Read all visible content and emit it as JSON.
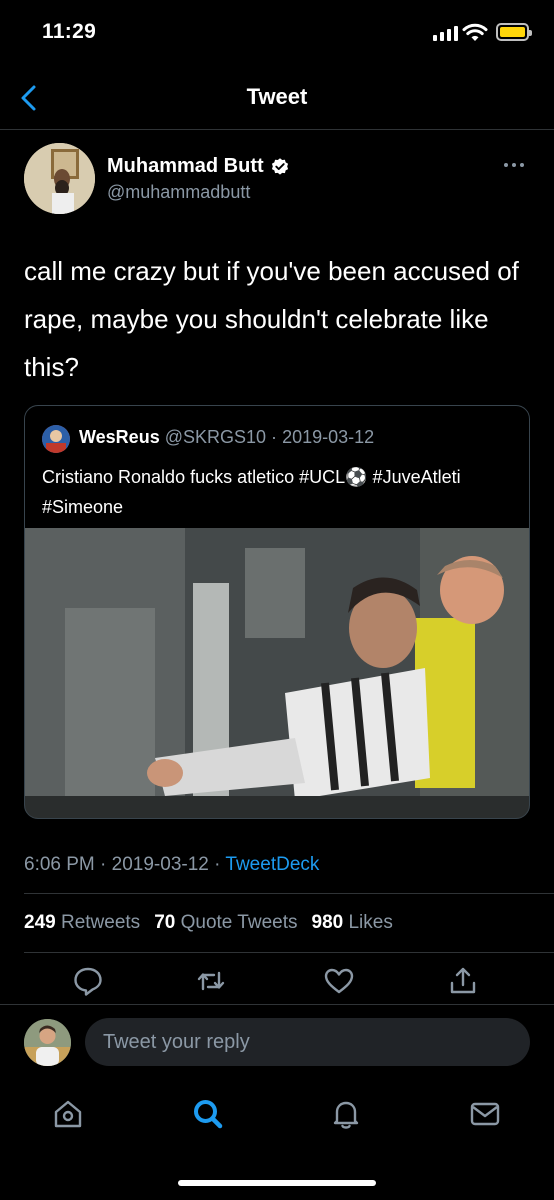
{
  "status_bar": {
    "time": "11:29"
  },
  "header": {
    "title": "Tweet"
  },
  "author": {
    "name": "Muhammad Butt",
    "handle": "@muhammadbutt",
    "verified": true
  },
  "tweet": {
    "text": "call me crazy but if you've been accused of rape, maybe you shouldn't celebrate like this?",
    "time": "6:06 PM",
    "date": "2019-03-12",
    "separator": "·",
    "source": "TweetDeck"
  },
  "quoted": {
    "name": "WesReus",
    "handle": "@SKRGS10",
    "date": "2019-03-12",
    "text": "Cristiano Ronaldo fucks atletico #UCL⚽ #JuveAtleti #Simeone"
  },
  "stats": {
    "retweets_count": "249",
    "retweets_label": "Retweets",
    "quotes_count": "70",
    "quotes_label": "Quote Tweets",
    "likes_count": "980",
    "likes_label": "Likes"
  },
  "reply": {
    "placeholder": "Tweet your reply"
  },
  "colors": {
    "accent": "#1d9bf0",
    "secondary_text": "#8b98a5",
    "border": "#2f3336",
    "battery": "#ffd60a"
  },
  "icons": {
    "back": "chevron-left-icon",
    "more": "ellipsis-icon",
    "reply": "comment-icon",
    "retweet": "retweet-icon",
    "like": "heart-icon",
    "share": "share-icon",
    "home": "home-icon",
    "search": "search-icon",
    "notifications": "bell-icon",
    "messages": "envelope-icon"
  },
  "tabs": {
    "active": "search"
  }
}
